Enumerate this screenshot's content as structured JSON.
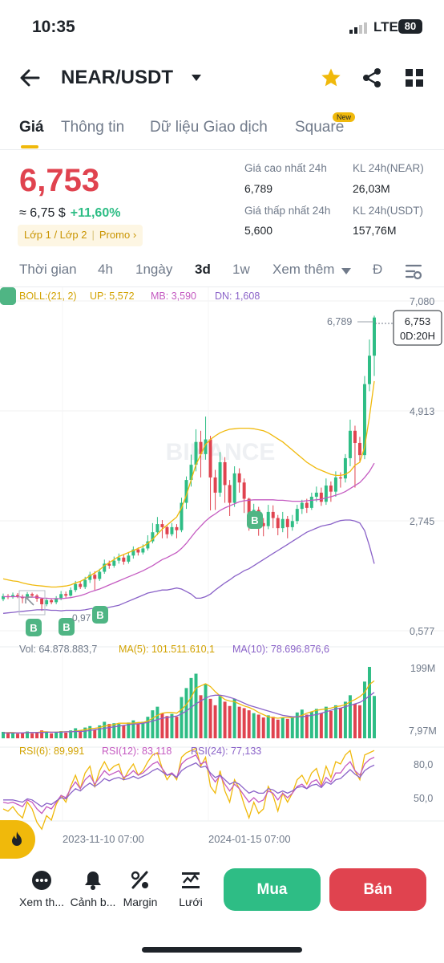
{
  "status_bar": {
    "time": "10:35",
    "network": "LTE",
    "battery": "80"
  },
  "header": {
    "pair": "NEAR/USDT",
    "icons": [
      "back-arrow-icon",
      "dropdown-caret-icon",
      "star-icon",
      "share-icon",
      "grid-icon"
    ]
  },
  "tabs": [
    {
      "label": "Giá",
      "active": true
    },
    {
      "label": "Thông tin"
    },
    {
      "label": "Dữ liệu Giao dịch"
    },
    {
      "label": "Square",
      "badge": "New"
    }
  ],
  "price": {
    "last": "6,753",
    "approx": "≈ 6,75 $",
    "change": "+11,60%",
    "promo": {
      "layer": "Lớp 1 / Lớp 2",
      "promo": "Promo"
    }
  },
  "stats": {
    "high_label": "Giá cao nhất 24h",
    "high": "6,789",
    "vol_base_label": "KL 24h(NEAR)",
    "vol_base": "26,03M",
    "low_label": "Giá thấp nhất 24h",
    "low": "5,600",
    "vol_quote_label": "KL 24h(USDT)",
    "vol_quote": "157,76M"
  },
  "intervals": [
    {
      "label": "Thời gian"
    },
    {
      "label": "4h"
    },
    {
      "label": "1ngày"
    },
    {
      "label": "3d",
      "active": true
    },
    {
      "label": "1w"
    },
    {
      "label": "Xem thêm"
    },
    {
      "label": "Đ"
    }
  ],
  "colors": {
    "up": "#2ebd85",
    "down": "#e0434f",
    "accent": "#f0b90b",
    "boll_up": "#f0b90b",
    "boll_mb": "#c45ac1",
    "boll_dn": "#8a62c8"
  },
  "indicators": {
    "boll": "BOLL:(21, 2)",
    "up": "UP: 5,572",
    "mb": "MB: 3,590",
    "dn": "DN: 1,608",
    "vol": "Vol: 64.878.883,7",
    "ma5": "MA(5): 101.511.610,1",
    "ma10": "MA(10): 78.696.876,6",
    "rsi6": "RSI(6): 89,991",
    "rsi12": "RSI(12): 83,118",
    "rsi24": "RSI(24): 77,133"
  },
  "watermark": "BINANCE",
  "chart_data": {
    "type": "candlestick",
    "price_axis_labels": [
      "7,080",
      "4,913",
      "2,745",
      "0,577"
    ],
    "price_axis_values": [
      7.08,
      4.913,
      2.745,
      0.577
    ],
    "max_marker": "6,789",
    "min_marker": "0,97",
    "last_price_tag": "6,753",
    "countdown": "0D:20H",
    "volume_axis_labels": [
      "199M",
      "7,97M"
    ],
    "rsi_axis_labels": [
      "80,0",
      "50,0"
    ],
    "date_labels": [
      "2023-11-10 07:00",
      "2024-01-15 07:00"
    ],
    "buy_marker_label": "B",
    "candles": [
      [
        1.2,
        1.26,
        1.31,
        1.16
      ],
      [
        1.26,
        1.24,
        1.3,
        1.2
      ],
      [
        1.24,
        1.28,
        1.33,
        1.21
      ],
      [
        1.28,
        1.25,
        1.32,
        1.22
      ],
      [
        1.25,
        1.22,
        1.29,
        1.12
      ],
      [
        1.22,
        1.3,
        1.34,
        1.19
      ],
      [
        1.3,
        1.27,
        1.33,
        1.23
      ],
      [
        1.27,
        1.21,
        1.3,
        1.15
      ],
      [
        1.21,
        1.1,
        1.23,
        0.97
      ],
      [
        1.1,
        1.18,
        1.22,
        1.06
      ],
      [
        1.18,
        1.14,
        1.21,
        1.1
      ],
      [
        1.14,
        1.22,
        1.26,
        1.1
      ],
      [
        1.22,
        1.3,
        1.36,
        1.18
      ],
      [
        1.3,
        1.27,
        1.35,
        1.23
      ],
      [
        1.27,
        1.38,
        1.43,
        1.25
      ],
      [
        1.38,
        1.5,
        1.56,
        1.34
      ],
      [
        1.5,
        1.44,
        1.55,
        1.4
      ],
      [
        1.44,
        1.58,
        1.64,
        1.4
      ],
      [
        1.58,
        1.68,
        1.74,
        1.52
      ],
      [
        1.68,
        1.6,
        1.75,
        1.38
      ],
      [
        1.6,
        1.74,
        1.8,
        1.56
      ],
      [
        1.74,
        1.9,
        1.98,
        1.7
      ],
      [
        1.9,
        1.86,
        1.96,
        1.8
      ],
      [
        1.86,
        1.96,
        2.04,
        1.82
      ],
      [
        1.96,
        2.02,
        2.1,
        1.9
      ],
      [
        2.02,
        1.94,
        2.08,
        1.88
      ],
      [
        1.94,
        2.06,
        2.12,
        1.9
      ],
      [
        2.06,
        2.18,
        2.24,
        2.0
      ],
      [
        2.18,
        2.12,
        2.22,
        2.06
      ],
      [
        2.12,
        2.2,
        2.28,
        2.08
      ],
      [
        2.2,
        2.34,
        2.46,
        2.16
      ],
      [
        2.34,
        2.52,
        2.7,
        2.3
      ],
      [
        2.52,
        2.68,
        2.82,
        2.46
      ],
      [
        2.68,
        2.62,
        2.76,
        2.4
      ],
      [
        2.62,
        2.48,
        2.66,
        2.4
      ],
      [
        2.48,
        2.62,
        2.7,
        2.44
      ],
      [
        2.62,
        2.56,
        2.68,
        2.4
      ],
      [
        2.56,
        3.1,
        3.2,
        2.52
      ],
      [
        3.1,
        3.55,
        3.62,
        2.98
      ],
      [
        3.55,
        3.85,
        4.05,
        3.42
      ],
      [
        3.85,
        4.3,
        4.55,
        3.72
      ],
      [
        4.3,
        4.06,
        4.52,
        3.6
      ],
      [
        4.06,
        4.35,
        4.8,
        3.95
      ],
      [
        4.35,
        3.6,
        4.42,
        2.95
      ],
      [
        3.6,
        3.3,
        3.75,
        2.96
      ],
      [
        3.3,
        3.9,
        4.1,
        3.22
      ],
      [
        3.9,
        3.45,
        4.0,
        3.1
      ],
      [
        3.45,
        3.1,
        3.55,
        2.84
      ],
      [
        3.1,
        3.68,
        3.82,
        3.02
      ],
      [
        3.68,
        3.5,
        3.78,
        3.3
      ],
      [
        3.5,
        3.18,
        3.58,
        2.9
      ],
      [
        3.18,
        2.8,
        3.2,
        2.55
      ],
      [
        2.8,
        2.96,
        3.08,
        2.62
      ],
      [
        2.96,
        2.7,
        3.02,
        2.45
      ],
      [
        2.7,
        2.64,
        2.8,
        2.44
      ],
      [
        2.64,
        2.92,
        3.06,
        2.58
      ],
      [
        2.92,
        2.8,
        3.05,
        2.6
      ],
      [
        2.8,
        2.6,
        2.86,
        2.46
      ],
      [
        2.6,
        2.78,
        2.92,
        2.52
      ],
      [
        2.78,
        2.62,
        2.84,
        2.4
      ],
      [
        2.62,
        2.74,
        2.86,
        2.55
      ],
      [
        2.74,
        2.98,
        3.06,
        2.68
      ],
      [
        2.98,
        3.1,
        3.16,
        2.88
      ],
      [
        3.1,
        3.0,
        3.18,
        2.9
      ],
      [
        3.0,
        3.22,
        3.3,
        2.96
      ],
      [
        3.22,
        3.3,
        3.42,
        3.12
      ],
      [
        3.3,
        3.12,
        3.4,
        3.04
      ],
      [
        3.12,
        3.44,
        3.58,
        3.06
      ],
      [
        3.44,
        3.32,
        3.52,
        3.12
      ],
      [
        3.32,
        3.6,
        3.72,
        3.22
      ],
      [
        3.6,
        3.58,
        3.7,
        3.4
      ],
      [
        3.58,
        3.98,
        4.06,
        3.5
      ],
      [
        3.98,
        4.52,
        4.74,
        3.82
      ],
      [
        4.52,
        4.28,
        4.62,
        3.4
      ],
      [
        4.28,
        4.04,
        4.4,
        3.9
      ],
      [
        4.04,
        5.44,
        5.6,
        3.96
      ],
      [
        5.44,
        6.0,
        6.32,
        5.3
      ],
      [
        6.0,
        6.753,
        6.789,
        5.6
      ]
    ],
    "boll_up": [
      1.6,
      1.58,
      1.56,
      1.55,
      1.52,
      1.5,
      1.48,
      1.47,
      1.46,
      1.45,
      1.44,
      1.44,
      1.45,
      1.46,
      1.48,
      1.52,
      1.55,
      1.6,
      1.66,
      1.72,
      1.78,
      1.86,
      1.92,
      1.98,
      2.04,
      2.08,
      2.12,
      2.16,
      2.2,
      2.24,
      2.3,
      2.38,
      2.48,
      2.58,
      2.66,
      2.74,
      2.82,
      3.0,
      3.25,
      3.55,
      3.85,
      4.05,
      4.25,
      4.35,
      4.42,
      4.48,
      4.52,
      4.55,
      4.56,
      4.57,
      4.57,
      4.57,
      4.56,
      4.54,
      4.52,
      4.48,
      4.42,
      4.36,
      4.3,
      4.22,
      4.14,
      4.06,
      3.98,
      3.9,
      3.84,
      3.78,
      3.74,
      3.7,
      3.66,
      3.64,
      3.64,
      3.66,
      3.72,
      3.84,
      3.9,
      4.2,
      4.8,
      5.5
    ],
    "boll_mb": [
      1.25,
      1.25,
      1.25,
      1.25,
      1.24,
      1.24,
      1.24,
      1.24,
      1.22,
      1.22,
      1.21,
      1.21,
      1.21,
      1.22,
      1.23,
      1.25,
      1.27,
      1.3,
      1.34,
      1.37,
      1.4,
      1.44,
      1.48,
      1.52,
      1.56,
      1.6,
      1.64,
      1.68,
      1.72,
      1.76,
      1.81,
      1.86,
      1.92,
      1.98,
      2.02,
      2.07,
      2.12,
      2.2,
      2.3,
      2.42,
      2.54,
      2.64,
      2.74,
      2.82,
      2.88,
      2.95,
      3.0,
      3.04,
      3.08,
      3.12,
      3.14,
      3.15,
      3.16,
      3.16,
      3.16,
      3.16,
      3.16,
      3.15,
      3.15,
      3.14,
      3.13,
      3.13,
      3.13,
      3.14,
      3.15,
      3.16,
      3.17,
      3.2,
      3.22,
      3.25,
      3.28,
      3.32,
      3.38,
      3.44,
      3.5,
      3.6,
      3.72,
      3.88
    ],
    "boll_dn": [
      0.92,
      0.93,
      0.94,
      0.95,
      0.96,
      0.97,
      0.98,
      0.99,
      0.99,
      0.99,
      0.98,
      0.98,
      0.97,
      0.98,
      0.98,
      0.98,
      0.98,
      0.99,
      1.01,
      1.02,
      1.02,
      1.02,
      1.04,
      1.06,
      1.08,
      1.12,
      1.16,
      1.2,
      1.24,
      1.28,
      1.32,
      1.34,
      1.36,
      1.38,
      1.38,
      1.4,
      1.42,
      1.4,
      1.35,
      1.3,
      1.22,
      1.22,
      1.25,
      1.3,
      1.38,
      1.45,
      1.52,
      1.58,
      1.65,
      1.7,
      1.76,
      1.8,
      1.86,
      1.92,
      1.98,
      2.04,
      2.1,
      2.16,
      2.22,
      2.28,
      2.34,
      2.4,
      2.46,
      2.52,
      2.56,
      2.6,
      2.64,
      2.66,
      2.68,
      2.72,
      2.75,
      2.76,
      2.76,
      2.74,
      2.7,
      2.55,
      2.25,
      1.9
    ],
    "volume": [
      18,
      14,
      16,
      13,
      15,
      19,
      14,
      17,
      22,
      16,
      14,
      18,
      20,
      16,
      22,
      28,
      22,
      30,
      34,
      24,
      36,
      46,
      40,
      42,
      40,
      36,
      44,
      50,
      42,
      46,
      60,
      78,
      88,
      70,
      62,
      68,
      60,
      115,
      140,
      168,
      180,
      120,
      150,
      110,
      92,
      118,
      102,
      90,
      110,
      88,
      84,
      78,
      70,
      66,
      58,
      64,
      60,
      52,
      58,
      54,
      60,
      72,
      80,
      66,
      74,
      82,
      70,
      88,
      76,
      92,
      84,
      102,
      120,
      96,
      92,
      158,
      199,
      118
    ],
    "ma5": [
      15,
      16,
      16,
      15,
      15,
      16,
      16,
      16,
      18,
      18,
      17,
      17,
      18,
      18,
      18,
      20,
      22,
      24,
      27,
      28,
      30,
      34,
      36,
      38,
      42,
      42,
      42,
      42,
      44,
      44,
      48,
      56,
      64,
      70,
      72,
      72,
      70,
      80,
      94,
      114,
      140,
      146,
      152,
      144,
      130,
      118,
      108,
      104,
      102,
      96,
      90,
      86,
      80,
      72,
      66,
      60,
      58,
      56,
      58,
      58,
      58,
      60,
      64,
      70,
      74,
      78,
      80,
      82,
      84,
      88,
      90,
      94,
      102,
      108,
      116,
      128,
      150,
      160
    ],
    "ma10": [
      15,
      15,
      15,
      15,
      15,
      16,
      16,
      16,
      16,
      17,
      17,
      17,
      17,
      18,
      18,
      19,
      19,
      20,
      22,
      24,
      26,
      28,
      30,
      32,
      34,
      36,
      38,
      40,
      40,
      42,
      44,
      48,
      52,
      56,
      58,
      60,
      62,
      68,
      76,
      86,
      96,
      104,
      112,
      118,
      120,
      120,
      118,
      114,
      110,
      104,
      98,
      92,
      88,
      84,
      80,
      76,
      72,
      68,
      64,
      62,
      60,
      60,
      60,
      62,
      64,
      66,
      70,
      74,
      78,
      82,
      84,
      88,
      92,
      96,
      100,
      108,
      118,
      128
    ],
    "rsi6": [
      40,
      38,
      42,
      36,
      32,
      46,
      40,
      28,
      22,
      34,
      30,
      44,
      52,
      46,
      60,
      70,
      58,
      72,
      78,
      60,
      74,
      82,
      74,
      78,
      80,
      66,
      74,
      80,
      70,
      74,
      82,
      88,
      90,
      76,
      66,
      72,
      66,
      86,
      90,
      92,
      94,
      78,
      86,
      60,
      54,
      74,
      56,
      46,
      66,
      58,
      44,
      32,
      46,
      36,
      40,
      60,
      52,
      38,
      54,
      46,
      54,
      66,
      70,
      62,
      72,
      76,
      62,
      78,
      68,
      82,
      80,
      88,
      92,
      74,
      66,
      88,
      90,
      92
    ],
    "rsi12": [
      46,
      45,
      46,
      44,
      42,
      48,
      46,
      40,
      36,
      42,
      40,
      46,
      52,
      50,
      58,
      64,
      58,
      66,
      70,
      62,
      68,
      74,
      70,
      72,
      74,
      68,
      70,
      74,
      70,
      72,
      76,
      80,
      82,
      76,
      70,
      72,
      68,
      80,
      84,
      86,
      88,
      80,
      82,
      70,
      64,
      70,
      62,
      56,
      62,
      58,
      52,
      46,
      50,
      46,
      48,
      56,
      54,
      48,
      54,
      50,
      54,
      60,
      62,
      58,
      64,
      66,
      60,
      68,
      64,
      72,
      72,
      78,
      82,
      74,
      70,
      80,
      84,
      86
    ],
    "rsi24": [
      48,
      48,
      48,
      47,
      46,
      49,
      48,
      45,
      42,
      45,
      44,
      47,
      50,
      49,
      54,
      58,
      56,
      60,
      63,
      60,
      63,
      67,
      65,
      67,
      68,
      66,
      67,
      69,
      67,
      69,
      71,
      74,
      76,
      73,
      70,
      71,
      68,
      74,
      77,
      79,
      81,
      77,
      78,
      72,
      68,
      70,
      66,
      62,
      64,
      62,
      58,
      54,
      56,
      54,
      54,
      58,
      57,
      54,
      56,
      54,
      56,
      59,
      60,
      58,
      61,
      62,
      59,
      64,
      62,
      66,
      67,
      71,
      75,
      71,
      68,
      74,
      77,
      79
    ]
  },
  "bottom_nav": [
    {
      "label": "Xem th...",
      "icon": "more-dots-icon"
    },
    {
      "label": "Cảnh b...",
      "icon": "bell-icon"
    },
    {
      "label": "Margin",
      "icon": "percent-icon"
    },
    {
      "label": "Lưới",
      "icon": "grid-bot-icon"
    }
  ],
  "actions": {
    "buy": "Mua",
    "sell": "Bán"
  }
}
